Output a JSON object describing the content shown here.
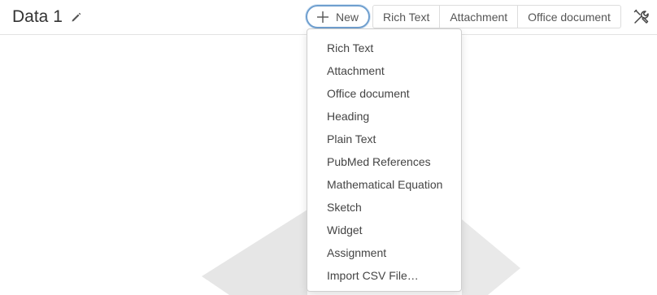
{
  "header": {
    "title": "Data 1",
    "new_label": "New",
    "quick_buttons": [
      "Rich Text",
      "Attachment",
      "Office document"
    ]
  },
  "dropdown": {
    "items": [
      "Rich Text",
      "Attachment",
      "Office document",
      "Heading",
      "Plain Text",
      "PubMed References",
      "Mathematical Equation",
      "Sketch",
      "Widget",
      "Assignment",
      "Import CSV File…"
    ]
  },
  "icons": {
    "edit": "pencil-icon",
    "new": "plus-icon",
    "tools": "tools-icon"
  },
  "colors": {
    "accent_border": "#6f9fcf",
    "divider": "#e3e3e3",
    "placeholder_shape": "#e6e6e6"
  }
}
